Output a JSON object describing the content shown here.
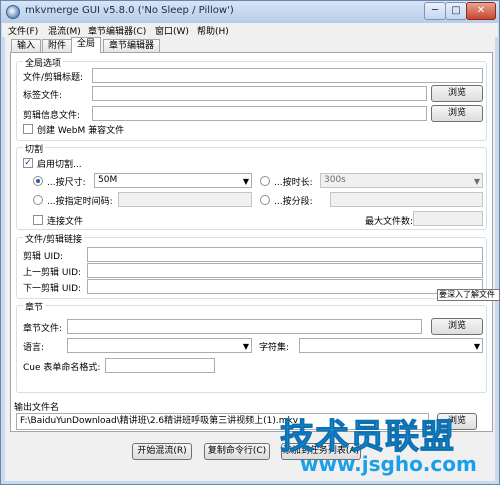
{
  "window": {
    "title": "mkvmerge GUI v5.8.0 ('No Sleep / Pillow')",
    "buttons": {
      "minimize": "─",
      "maximize": "□",
      "close": "✕"
    }
  },
  "menu": [
    "文件(F)",
    "混流(M)",
    "章节编辑器(C)",
    "窗口(W)",
    "帮助(H)"
  ],
  "tabs": [
    "输入",
    "附件",
    "全局",
    "章节编辑器"
  ],
  "active_tab": "全局",
  "global_options": {
    "title": "全局选项",
    "file_title_label": "文件/剪辑标题:",
    "file_title_value": "",
    "tags_label": "标签文件:",
    "tags_value": "",
    "tags_browse": "浏览",
    "segment_info_label": "剪辑信息文件:",
    "segment_info_value": "",
    "segment_info_browse": "浏览",
    "webm_label": "创建 WebM 兼容文件",
    "webm_checked": false
  },
  "split": {
    "title": "切割",
    "enable_label": "启用切割...",
    "enable_checked": true,
    "by_size_label": "...按尺寸:",
    "by_size_value": "50M",
    "by_time_label": "...按时长:",
    "by_time_value": "300s",
    "by_timecodes_label": "...按指定时间码:",
    "by_parts_label": "...按分段:",
    "link_label": "连接文件",
    "max_files_label": "最大文件数:",
    "selected": "size"
  },
  "linking": {
    "title": "文件/剪辑链接",
    "segment_uid_label": "剪辑 UID:",
    "prev_uid_label": "上一剪辑 UID:",
    "next_uid_label": "下一剪辑 UID:"
  },
  "chapters": {
    "title": "章节",
    "file_label": "章节文件:",
    "browse": "浏览",
    "language_label": "语言:",
    "charset_label": "字符集:",
    "cue_label": "Cue 表单命名格式:"
  },
  "output": {
    "title": "输出文件名",
    "path": "F:\\BaiduYunDownload\\精讲班\\2.6精讲班呼吸第三讲视频上(1).mkv",
    "browse": "浏览"
  },
  "actions": {
    "start": "开始混流(R)",
    "copy": "复制命令行(C)",
    "add_queue": "添加到任务列表(A)"
  },
  "tooltip": "要深入了解文件",
  "watermark": {
    "line1": "技术员联盟",
    "line2": "www.jsgho.com"
  }
}
